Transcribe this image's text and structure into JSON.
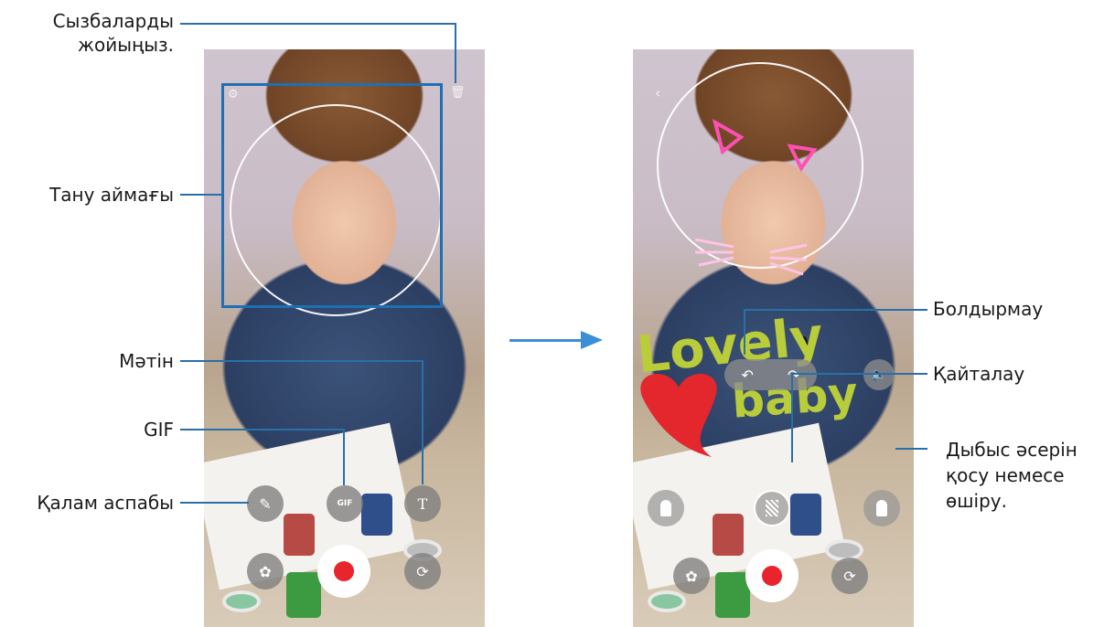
{
  "labels": {
    "delete_drawings": "Сызбаларды\nжойыңыз.",
    "recognition_area": "Тану аймағы",
    "text": "Мәтін",
    "gif": "GIF",
    "pen_tool": "Қалам аспабы",
    "undo": "Болдырмау",
    "redo": "Қайталау",
    "sound_effect": "Дыбыс әсерін\nқосу немесе\nөшіру."
  },
  "left_phone": {
    "buttons": {
      "settings_icon": "⚙",
      "trash_icon": "🗑",
      "pen_icon": "✎",
      "gif_icon": "GIF",
      "text_icon": "T",
      "effects_icon": "✿",
      "flip_icon": "⟳"
    }
  },
  "right_phone": {
    "buttons": {
      "back_icon": "‹",
      "undo_icon": "↶",
      "redo_icon": "↷",
      "sound_icon": "🔈",
      "effects_icon": "✿",
      "flip_icon": "⟳"
    },
    "drawing_text": {
      "line1": "Lovely",
      "line2": "baby"
    }
  },
  "colors": {
    "callout": "#1f6fb2",
    "arrow": "#3b8ed8",
    "record": "#e8242c"
  }
}
